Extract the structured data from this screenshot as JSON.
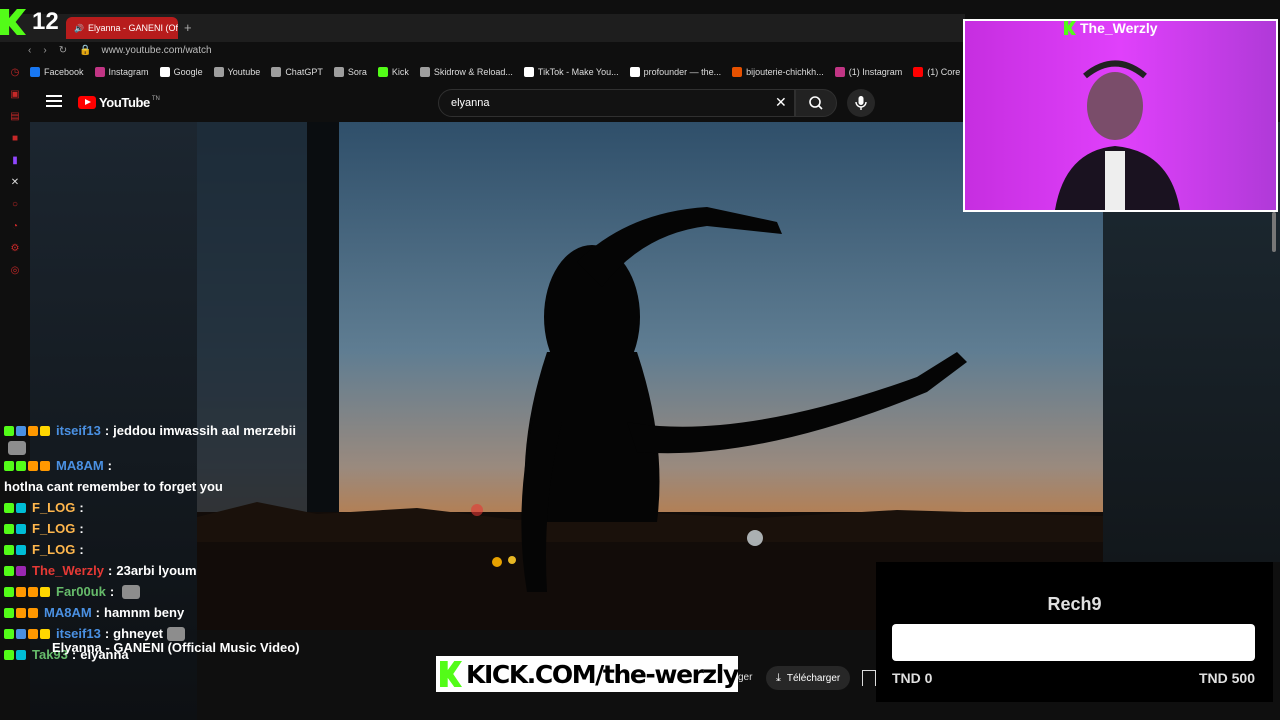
{
  "counter": {
    "value": "12"
  },
  "browser": {
    "tab_title": "Elyanna - GANENI (Offi",
    "address": "www.youtube.com/watch",
    "bookmarks": [
      {
        "label": "Facebook",
        "color": "#1877f2"
      },
      {
        "label": "Instagram",
        "color": "#c13584"
      },
      {
        "label": "Google",
        "color": "#ffffff"
      },
      {
        "label": "Youtube",
        "color": "#9e9e9e"
      },
      {
        "label": "ChatGPT",
        "color": "#9e9e9e"
      },
      {
        "label": "Sora",
        "color": "#9e9e9e"
      },
      {
        "label": "Kick",
        "color": "#53fc18"
      },
      {
        "label": "Skidrow & Reload...",
        "color": "#9e9e9e"
      },
      {
        "label": "TikTok - Make You...",
        "color": "#ffffff"
      },
      {
        "label": "profounder — the...",
        "color": "#ffffff"
      },
      {
        "label": "bijouterie-chichkh...",
        "color": "#e65100"
      },
      {
        "label": "(1) Instagram",
        "color": "#c13584"
      },
      {
        "label": "(1) Core men",
        "color": "#ff0000"
      }
    ]
  },
  "youtube": {
    "brand": "YouTube",
    "country": "TN",
    "search_value": "elyanna",
    "video_title": "Elyanna - GANENI (Official Music Video)",
    "download_label": "Télécharger",
    "partial_label": "ger"
  },
  "webcam": {
    "streamer": "The_Werzly"
  },
  "chat": [
    {
      "user": "itseif13",
      "color": "#4a90e2",
      "text": "jeddou imwassih aal merzebii",
      "emote": true,
      "badges": [
        "#53fc18",
        "#4a90e2",
        "#ff9800",
        "#ffd600"
      ]
    },
    {
      "user": "MA8AM",
      "color": "#4a90e2",
      "text": "hotlna cant remember to forget you",
      "emote": false,
      "badges": [
        "#53fc18",
        "#53fc18",
        "#ff9800",
        "#ff9800"
      ]
    },
    {
      "user": "F_LOG",
      "color": "#ffb74d",
      "text": "",
      "emote": false,
      "badges": [
        "#53fc18",
        "#00bcd4"
      ]
    },
    {
      "user": "F_LOG",
      "color": "#ffb74d",
      "text": "",
      "emote": false,
      "badges": [
        "#53fc18",
        "#00bcd4"
      ]
    },
    {
      "user": "F_LOG",
      "color": "#ffb74d",
      "text": "",
      "emote": false,
      "badges": [
        "#53fc18",
        "#00bcd4"
      ]
    },
    {
      "user": "The_Werzly",
      "color": "#e53935",
      "text": "23arbi lyoum",
      "emote": false,
      "badges": [
        "#53fc18",
        "#9c27b0"
      ]
    },
    {
      "user": "Far00uk",
      "color": "#66bb6a",
      "text": "",
      "emote": true,
      "badges": [
        "#53fc18",
        "#ff9800",
        "#ff9800",
        "#ffd600"
      ]
    },
    {
      "user": "MA8AM",
      "color": "#4a90e2",
      "text": "hamnm beny",
      "emote": false,
      "badges": [
        "#53fc18",
        "#ff9800",
        "#ff9800"
      ]
    },
    {
      "user": "itseif13",
      "color": "#4a90e2",
      "text": "ghneyet",
      "emote": true,
      "badges": [
        "#53fc18",
        "#4a90e2",
        "#ff9800",
        "#ffd600"
      ]
    },
    {
      "user": "Tak93",
      "color": "#66bb6a",
      "text": "elyanna",
      "emote": false,
      "badges": [
        "#53fc18",
        "#00bcd4"
      ]
    }
  ],
  "banner": {
    "text": "KICK.COM/the-werzly"
  },
  "goal": {
    "title": "Rech9",
    "current_label": "TND 0",
    "target_label": "TND 500",
    "progress": 0
  },
  "colors": {
    "kick_green": "#53fc18",
    "youtube_red": "#ff0000"
  }
}
